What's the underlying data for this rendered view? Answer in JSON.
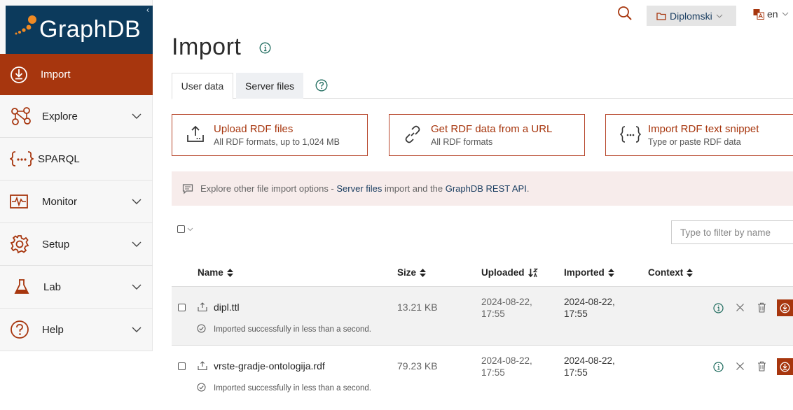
{
  "app": {
    "name": "GraphDB",
    "collapse_glyph": "‹"
  },
  "colors": {
    "brand_dark": "#0c3a5c",
    "accent": "#a7360e",
    "notice_bg": "#f7eceb",
    "link": "#1c3f62"
  },
  "sidebar": {
    "items": [
      {
        "label": "Import",
        "icon": "import-icon",
        "active": true
      },
      {
        "label": "Explore",
        "icon": "explore-icon",
        "expandable": true
      },
      {
        "label": "SPARQL",
        "icon": "sparql-icon"
      },
      {
        "label": "Monitor",
        "icon": "monitor-icon",
        "expandable": true
      },
      {
        "label": "Setup",
        "icon": "setup-gear-icon",
        "expandable": true
      },
      {
        "label": "Lab",
        "icon": "lab-flask-icon",
        "expandable": true
      },
      {
        "label": "Help",
        "icon": "help-icon",
        "expandable": true
      }
    ]
  },
  "topbar": {
    "repository": "Diplomski",
    "language": "en"
  },
  "page": {
    "title": "Import"
  },
  "tabs": [
    {
      "label": "User data",
      "active": true
    },
    {
      "label": "Server files",
      "active": false
    }
  ],
  "import_options": [
    {
      "title": "Upload RDF files",
      "subtitle": "All RDF formats, up to 1,024 MB",
      "icon": "upload-icon"
    },
    {
      "title": "Get RDF data from a URL",
      "subtitle": "All RDF formats",
      "icon": "link-icon"
    },
    {
      "title": "Import RDF text snippet",
      "subtitle": "Type or paste RDF data",
      "icon": "braces-icon"
    }
  ],
  "notice": {
    "text_before": "Explore other file import options - ",
    "link": "Server files",
    "text_middle": " import and the ",
    "api": "GraphDB REST API",
    "text_after": "."
  },
  "filter": {
    "placeholder": "Type to filter by name"
  },
  "table": {
    "columns": [
      "Name",
      "Size",
      "Uploaded",
      "Imported",
      "Context"
    ],
    "rows": [
      {
        "name": "dipl.ttl",
        "size": "13.21 KB",
        "uploaded_date": "2024-08-22,",
        "uploaded_time": "17:55",
        "imported_date": "2024-08-22,",
        "imported_time": "17:55",
        "context": "",
        "status": "Imported successfully in less than a second."
      },
      {
        "name": "vrste-gradje-ontologija.rdf",
        "size": "79.23 KB",
        "uploaded_date": "2024-08-22,",
        "uploaded_time": "17:55",
        "imported_date": "2024-08-22,",
        "imported_time": "17:55",
        "context": "",
        "status": "Imported successfully in less than a second."
      }
    ]
  }
}
